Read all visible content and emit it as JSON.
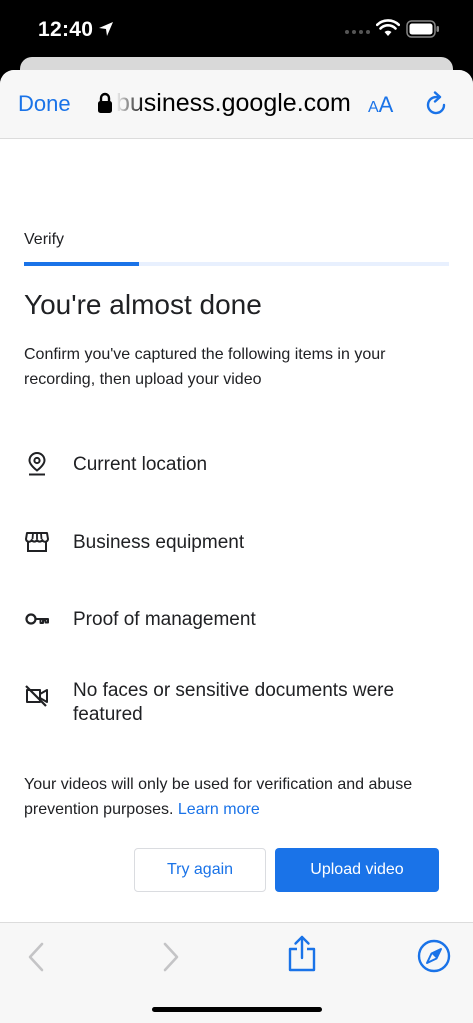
{
  "status_bar": {
    "time": "12:40",
    "icons": [
      "location-arrow-icon",
      "cellular-dots-icon",
      "wifi-icon",
      "battery-icon"
    ]
  },
  "browser": {
    "done_label": "Done",
    "url": "business.google.com",
    "text_size_label_small": "A",
    "text_size_label_large": "A",
    "icons": [
      "lock-icon",
      "reload-icon",
      "back-icon",
      "forward-icon",
      "share-icon",
      "compass-icon"
    ]
  },
  "page": {
    "step_label": "Verify",
    "progress": 0.27,
    "title": "You're almost done",
    "intro": "Confirm you've captured the following items in your recording, then upload your video",
    "checklist": [
      {
        "label": "Current location",
        "icon": "location-pin-icon"
      },
      {
        "label": "Business equipment",
        "icon": "storefront-icon"
      },
      {
        "label": "Proof of management",
        "icon": "key-icon"
      },
      {
        "label": "No faces or sensitive documents were featured",
        "icon": "video-off-icon"
      }
    ],
    "note": "Your videos will only be used for verification and abuse prevention purposes.",
    "learn_more": "Learn more",
    "try_again": "Try again",
    "upload": "Upload video"
  },
  "colors": {
    "accent": "#1a73e8",
    "progress_track": "#e8f0fe",
    "text": "#202124"
  }
}
